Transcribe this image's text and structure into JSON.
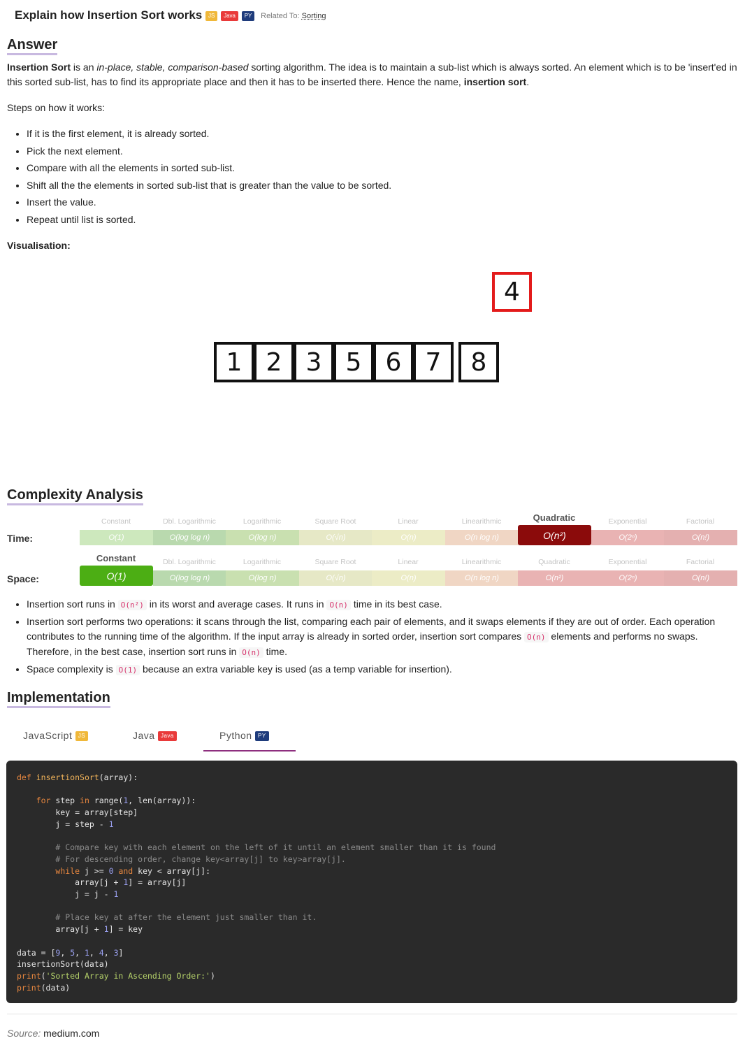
{
  "header": {
    "title": "Explain how Insertion Sort works",
    "badges": [
      "JS",
      "Java",
      "PY"
    ],
    "related_prefix": "Related To:",
    "related_link": "Sorting"
  },
  "answer": {
    "heading": "Answer",
    "intro_bold": "Insertion Sort",
    "intro_1": " is an ",
    "intro_em": "in-place, stable, comparison-based",
    "intro_2": " sorting algorithm. The idea is to maintain a sub-list which is always sorted. An element which is to be 'insert'ed in this sorted sub-list, has to find its appropriate place and then it has to be inserted there. Hence the name, ",
    "intro_bold2": "insertion sort",
    "intro_end": ".",
    "steps_intro": "Steps on how it works:",
    "steps": [
      "If it is the first element, it is already sorted.",
      "Pick the next element.",
      "Compare with all the elements in sorted sub-list.",
      "Shift all the the elements in sorted sub-list that is greater than the value to be sorted.",
      "Insert the value.",
      "Repeat until list is sorted."
    ],
    "visualisation_label": "Visualisation:"
  },
  "visualisation": {
    "sorted": [
      "1",
      "2",
      "3",
      "5",
      "6",
      "7"
    ],
    "next": "8",
    "lifted": "4"
  },
  "complexity": {
    "heading": "Complexity Analysis",
    "columns": [
      "Constant",
      "Dbl. Logarithmic",
      "Logarithmic",
      "Square Root",
      "Linear",
      "Linearithmic",
      "Quadratic",
      "Exponential",
      "Factorial"
    ],
    "cells": [
      "O(1)",
      "O(log log n)",
      "O(log n)",
      "O(√n)",
      "O(n)",
      "O(n log n)",
      "O(n²)",
      "O(2ⁿ)",
      "O(n!)"
    ],
    "colors": [
      "#cde8bd",
      "#b9d9ae",
      "#c9e0b0",
      "#e6e8c6",
      "#ececc6",
      "#f0d6c4",
      "#e9b3b3",
      "#e9b3b3",
      "#e4b0b0"
    ],
    "time": {
      "label": "Time:",
      "active": 6,
      "active_color": "#8b0b0b"
    },
    "space": {
      "label": "Space:",
      "active": 0,
      "active_color": "#4cae14"
    },
    "notes": {
      "n1a": "Insertion sort runs in ",
      "n1c1": "O(n²)",
      "n1b": " in its worst and average cases. It runs in ",
      "n1c2": "O(n)",
      "n1d": " time in its best case.",
      "n2a": "Insertion sort performs two operations: it scans through the list, comparing each pair of elements, and it swaps elements if they are out of order. Each operation contributes to the running time of the algorithm. If the input array is already in sorted order, insertion sort compares ",
      "n2c1": "O(n)",
      "n2b": " elements and performs no swaps. Therefore, in the best case, insertion sort runs in ",
      "n2c2": "O(n)",
      "n2d": " time.",
      "n3a": "Space complexity is ",
      "n3c1": "O(1)",
      "n3b": " because an extra variable key is used (as a temp variable for insertion)."
    }
  },
  "implementation": {
    "heading": "Implementation",
    "tabs": [
      {
        "label": "JavaScript",
        "badge": "JS"
      },
      {
        "label": "Java",
        "badge": "Java"
      },
      {
        "label": "Python",
        "badge": "PY"
      }
    ],
    "active_tab": "Python"
  },
  "footer": {
    "source_label": "Source:",
    "source_value": "medium.com"
  }
}
